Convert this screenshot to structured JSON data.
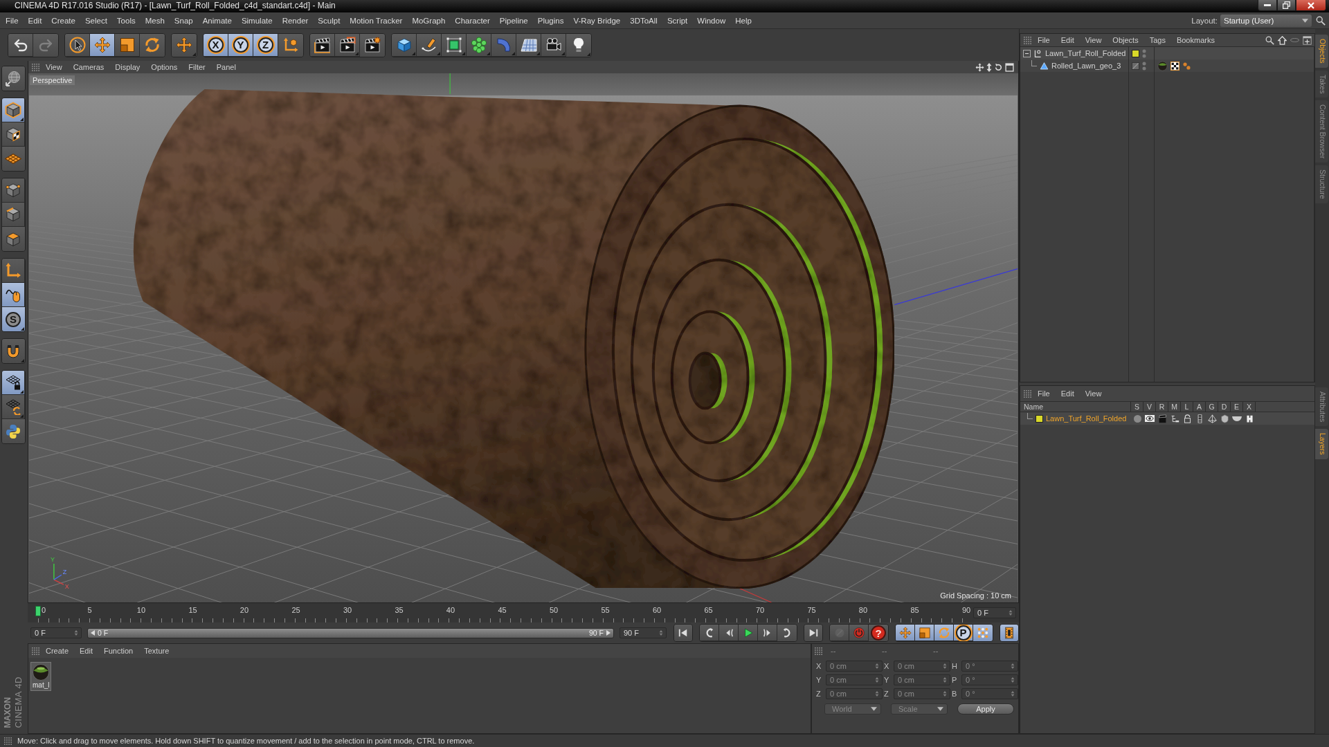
{
  "window": {
    "title": "CINEMA 4D R17.016 Studio (R17) - [Lawn_Turf_Roll_Folded_c4d_standart.c4d] - Main"
  },
  "menu": [
    "File",
    "Edit",
    "Create",
    "Select",
    "Tools",
    "Mesh",
    "Snap",
    "Animate",
    "Simulate",
    "Render",
    "Sculpt",
    "Motion Tracker",
    "MoGraph",
    "Character",
    "Pipeline",
    "Plugins",
    "V-Ray Bridge",
    "3DToAll",
    "Script",
    "Window",
    "Help"
  ],
  "layout": {
    "label": "Layout:",
    "value": "Startup (User)"
  },
  "toolbar": [
    [
      {
        "kind": "undo",
        "on": false,
        "disabled": false,
        "more": false
      },
      {
        "kind": "redo",
        "on": false,
        "disabled": true,
        "more": false
      }
    ],
    [
      {
        "kind": "select",
        "on": false,
        "disabled": false,
        "more": false
      },
      {
        "kind": "move",
        "on": true,
        "disabled": false,
        "more": false
      },
      {
        "kind": "scale",
        "on": false,
        "disabled": false,
        "more": false
      },
      {
        "kind": "rotate",
        "on": false,
        "disabled": false,
        "more": false
      }
    ],
    [
      {
        "kind": "recent",
        "on": false,
        "disabled": false,
        "more": true
      }
    ],
    [
      {
        "kind": "axis",
        "label": "X",
        "on": true,
        "disabled": false,
        "more": false
      },
      {
        "kind": "axis",
        "label": "Y",
        "on": true,
        "disabled": false,
        "more": false
      },
      {
        "kind": "axis",
        "label": "Z",
        "on": true,
        "disabled": false,
        "more": false
      },
      {
        "kind": "coord",
        "on": false,
        "disabled": false,
        "more": false
      }
    ],
    [
      {
        "kind": "render-view",
        "on": false,
        "disabled": false,
        "more": false
      },
      {
        "kind": "render",
        "on": false,
        "disabled": false,
        "more": true
      },
      {
        "kind": "render-settings",
        "on": false,
        "disabled": false,
        "more": false
      }
    ],
    [
      {
        "kind": "cube",
        "on": false,
        "disabled": false,
        "more": true
      },
      {
        "kind": "pen",
        "on": false,
        "disabled": false,
        "more": true
      },
      {
        "kind": "subdivision",
        "on": false,
        "disabled": false,
        "more": true
      },
      {
        "kind": "cloner",
        "on": false,
        "disabled": false,
        "more": true
      },
      {
        "kind": "deformer",
        "on": false,
        "disabled": false,
        "more": true
      },
      {
        "kind": "floor",
        "on": false,
        "disabled": false,
        "more": true
      },
      {
        "kind": "camera",
        "on": false,
        "disabled": false,
        "more": true
      },
      {
        "kind": "light",
        "on": false,
        "disabled": false,
        "more": true
      }
    ]
  ],
  "left_toolbar": [
    [
      {
        "kind": "make-editable",
        "on": false,
        "more": false
      }
    ],
    [
      {
        "kind": "model",
        "on": true,
        "more": true
      },
      {
        "kind": "texture",
        "on": false,
        "more": false
      },
      {
        "kind": "workplane",
        "on": false,
        "more": false
      }
    ],
    [
      {
        "kind": "points",
        "on": false,
        "more": false
      },
      {
        "kind": "edges",
        "on": false,
        "more": false
      },
      {
        "kind": "polygons",
        "on": false,
        "more": false
      }
    ],
    [
      {
        "kind": "axis-mode",
        "on": false,
        "more": false
      },
      {
        "kind": "tweak",
        "on": true,
        "more": false
      },
      {
        "kind": "solo",
        "label": "S",
        "on": true,
        "more": true
      }
    ],
    [
      {
        "kind": "snap",
        "on": false,
        "more": true
      }
    ],
    [
      {
        "kind": "workplane-lock",
        "on": true,
        "more": true
      },
      {
        "kind": "workplane-align",
        "on": false,
        "more": true
      },
      {
        "kind": "python",
        "on": false,
        "more": false
      }
    ]
  ],
  "logo": {
    "brand": "MAXON",
    "product": "CINEMA 4D"
  },
  "viewport": {
    "menu": [
      "View",
      "Cameras",
      "Display",
      "Options",
      "Filter",
      "Panel"
    ],
    "camera": "Perspective",
    "grid_spacing": "Grid Spacing : 10 cm",
    "gizmo_labels": [
      "Y",
      "Z",
      "X"
    ]
  },
  "timeline": {
    "ticks": [
      "0",
      "5",
      "10",
      "15",
      "20",
      "25",
      "30",
      "35",
      "40",
      "45",
      "50",
      "55",
      "60",
      "65",
      "70",
      "75",
      "80",
      "85",
      "90"
    ],
    "level": 0,
    "current_frame": "0 F"
  },
  "range": {
    "start_field": "0 F",
    "slider_start": "0 F",
    "slider_end": "90 F",
    "end_field": "90 F",
    "level": 1
  },
  "transport": [
    [
      {
        "kind": "first",
        "on": false,
        "disabled": false
      }
    ],
    [
      {
        "kind": "prev-key",
        "on": false,
        "disabled": false
      },
      {
        "kind": "prev-frame",
        "on": false,
        "disabled": false
      },
      {
        "kind": "play",
        "on": false,
        "disabled": false
      },
      {
        "kind": "next-frame",
        "on": false,
        "disabled": false
      },
      {
        "kind": "next-key",
        "on": false,
        "disabled": false
      }
    ],
    [
      {
        "kind": "last",
        "on": false,
        "disabled": false
      }
    ],
    [
      {
        "kind": "motion-path",
        "on": false,
        "disabled": true
      },
      {
        "kind": "record",
        "on": false,
        "disabled": false
      },
      {
        "kind": "autokey",
        "label": "?",
        "on": false,
        "disabled": false
      }
    ],
    [
      {
        "kind": "key-move",
        "on": true,
        "disabled": false
      },
      {
        "kind": "key-scale",
        "on": true,
        "disabled": false
      },
      {
        "kind": "key-rotate",
        "on": true,
        "disabled": false
      },
      {
        "kind": "key-param",
        "label": "P",
        "on": true,
        "disabled": false
      },
      {
        "kind": "key-pla",
        "on": true,
        "disabled": false
      }
    ],
    [
      {
        "kind": "timeline",
        "on": true,
        "disabled": false
      }
    ]
  ],
  "materials": {
    "menu": [
      "Create",
      "Edit",
      "Function",
      "Texture"
    ],
    "items": [
      {
        "name": "mat_l"
      }
    ]
  },
  "coordinates": {
    "headers": [
      "--",
      "--",
      "--"
    ],
    "rows": [
      {
        "axis": "X",
        "position": "0 cm",
        "size_axis": "X",
        "size": "0 cm",
        "rotation_axis": "H",
        "rotation": "0 °"
      },
      {
        "axis": "Y",
        "position": "0 cm",
        "size_axis": "Y",
        "size": "0 cm",
        "rotation_axis": "P",
        "rotation": "0 °"
      },
      {
        "axis": "Z",
        "position": "0 cm",
        "size_axis": "Z",
        "size": "0 cm",
        "rotation_axis": "B",
        "rotation": "0 °"
      }
    ],
    "coordinate_system": "World",
    "mode": "Scale",
    "apply": "Apply"
  },
  "objects": {
    "menu": [
      "File",
      "Edit",
      "View",
      "Objects",
      "Tags",
      "Bookmarks"
    ],
    "rows": [
      {
        "name": "Lawn_Turf_Roll_Folded",
        "kind": "null",
        "color": "#d8d82a",
        "expanded": true,
        "children": [
          {
            "name": "Rolled_Lawn_geo_3",
            "kind": "polygon",
            "tags": [
              {
                "kind": "material"
              },
              {
                "kind": "texture"
              },
              {
                "kind": "dots"
              }
            ]
          }
        ]
      }
    ]
  },
  "layers": {
    "menu": [
      "File",
      "Edit",
      "View"
    ],
    "columns": [
      "Name",
      "S",
      "V",
      "R",
      "M",
      "L",
      "A",
      "G",
      "D",
      "E",
      "X"
    ],
    "rows": [
      {
        "name": "Lawn_Turf_Roll_Folded",
        "color": "#d8d82a"
      }
    ]
  },
  "side_tabs": {
    "upper": [
      {
        "label": "Objects",
        "selected": true
      },
      {
        "label": "Takes",
        "selected": false
      },
      {
        "label": "Content Browser",
        "selected": false
      },
      {
        "label": "Structure",
        "selected": false
      }
    ],
    "lower": [
      {
        "label": "Attributes",
        "selected": false
      },
      {
        "label": "Layers",
        "selected": true
      }
    ]
  },
  "status_bar": "Move: Click and drag to move elements. Hold down SHIFT to quantize movement / add to the selection in point mode, CTRL to remove."
}
